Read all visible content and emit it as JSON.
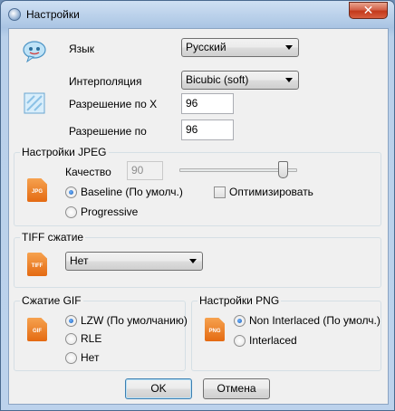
{
  "window": {
    "title": "Настройки",
    "close_label": "✕"
  },
  "language": {
    "label": "Язык",
    "value": "Русский"
  },
  "interpolation": {
    "label": "Интерполяция",
    "value": "Bicubic (soft)"
  },
  "resolution_x": {
    "label": "Разрешение по X",
    "value": "96"
  },
  "resolution_y": {
    "label": "Разрешение по",
    "value": "96"
  },
  "jpeg": {
    "title": "Настройки JPEG",
    "icon_text": "JPG",
    "quality_label": "Качество",
    "quality_value": "90",
    "slider_fraction": 0.88,
    "baseline_label": "Baseline (По умолч.)",
    "progressive_label": "Progressive",
    "optimize_label": "Оптимизировать"
  },
  "tiff": {
    "title": "TIFF сжатие",
    "icon_text": "TIFF",
    "value": "Нет"
  },
  "gif": {
    "title": "Сжатие GIF",
    "icon_text": "GIF",
    "options": [
      "LZW (По умолчанию)",
      "RLE",
      "Нет"
    ]
  },
  "png": {
    "title": "Настройки PNG",
    "icon_text": "PNG",
    "options": [
      "Non Interlaced (По умолч.)",
      "Interlaced"
    ]
  },
  "buttons": {
    "ok": "OK",
    "cancel": "Отмена"
  }
}
